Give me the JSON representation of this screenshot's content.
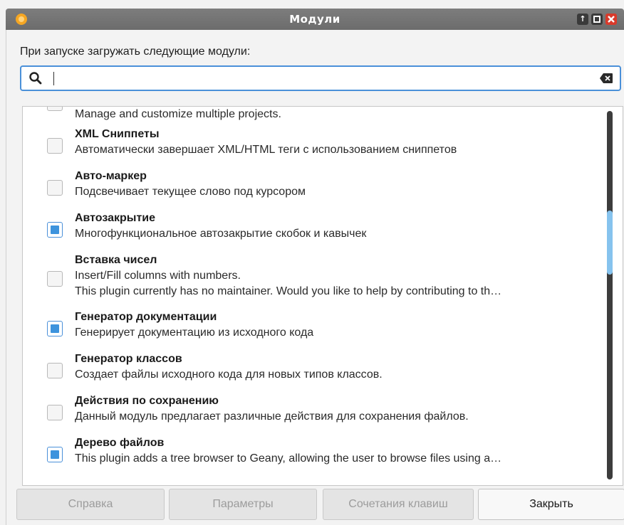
{
  "window": {
    "title": "Модули"
  },
  "prompt": "При запуске загружать следующие модули:",
  "search": {
    "value": "",
    "placeholder": ""
  },
  "plugins": [
    {
      "name": "",
      "description": "Manage and customize multiple projects.",
      "checked": false
    },
    {
      "name": "XML Сниппеты",
      "description": "Автоматически завершает XML/HTML теги с использованием сниппетов",
      "checked": false
    },
    {
      "name": "Авто-маркер",
      "description": "Подсвечивает текущее слово под курсором",
      "checked": false
    },
    {
      "name": "Автозакрытие",
      "description": "Многофункциональное автозакрытие скобок и кавычек",
      "checked": true
    },
    {
      "name": "Вставка чисел",
      "description": "Insert/Fill columns with numbers.",
      "description2": "This plugin currently has no maintainer. Would you like to help by contributing to th…",
      "checked": false
    },
    {
      "name": "Генератор документации",
      "description": "Генерирует документацию из исходного кода",
      "checked": true
    },
    {
      "name": "Генератор классов",
      "description": "Создает файлы исходного кода для новых типов классов.",
      "checked": false
    },
    {
      "name": "Действия по сохранению",
      "description": "Данный модуль предлагает различные действия для сохранения файлов.",
      "checked": false
    },
    {
      "name": "Дерево файлов",
      "description": "This plugin adds a tree browser to Geany, allowing the user to browse files using a…",
      "checked": true
    }
  ],
  "buttons": {
    "help": "Справка",
    "preferences": "Параметры",
    "keybindings": "Сочетания клавиш",
    "close": "Закрыть"
  },
  "colors": {
    "accent": "#3d93dd",
    "titlebar": "#757575",
    "close": "#d93a2b"
  }
}
